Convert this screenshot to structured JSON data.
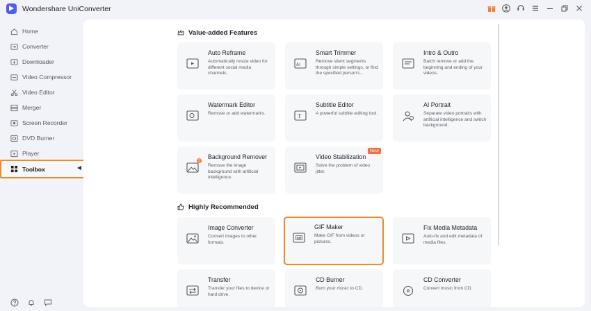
{
  "window": {
    "title": "Wondershare UniConverter"
  },
  "sidebar": {
    "items": [
      {
        "label": "Home",
        "icon": "home-icon"
      },
      {
        "label": "Converter",
        "icon": "converter-icon"
      },
      {
        "label": "Downloader",
        "icon": "download-icon"
      },
      {
        "label": "Video Compressor",
        "icon": "compress-icon"
      },
      {
        "label": "Video Editor",
        "icon": "scissors-icon"
      },
      {
        "label": "Merger",
        "icon": "merge-icon"
      },
      {
        "label": "Screen Recorder",
        "icon": "record-icon"
      },
      {
        "label": "DVD Burner",
        "icon": "disc-icon"
      },
      {
        "label": "Player",
        "icon": "player-icon"
      },
      {
        "label": "Toolbox",
        "icon": "toolbox-icon",
        "active": true
      }
    ]
  },
  "sections": {
    "value_added": {
      "title": "Value-added Features",
      "cards": [
        {
          "title": "Auto Reframe",
          "desc": "Automatically resize video for different social media channels."
        },
        {
          "title": "Smart Trimmer",
          "desc": "Remove silent segments through simple settings, or find the specified person's..."
        },
        {
          "title": "Intro & Outro",
          "desc": "Batch remove or add the beginning and ending of your videos."
        },
        {
          "title": "Watermark Editor",
          "desc": "Remove or add watermarks."
        },
        {
          "title": "Subtitle Editor",
          "desc": "A powerful subtitle editing tool."
        },
        {
          "title": "AI Portrait",
          "desc": "Separate video portraits with artificial intelligence and switch background."
        },
        {
          "title": "Background Remover",
          "desc": "Remove the image background with artificial intelligence."
        },
        {
          "title": "Video Stabilization",
          "desc": "Solve the problem of video jitter.",
          "badge": "New"
        }
      ]
    },
    "recommended": {
      "title": "Highly Recommended",
      "cards": [
        {
          "title": "Image Converter",
          "desc": "Convert images to other formats."
        },
        {
          "title": "GIF Maker",
          "desc": "Make GIF from videos or pictures."
        },
        {
          "title": "Fix Media Metadata",
          "desc": "Auto-fix and edit metadata of media files."
        },
        {
          "title": "Transfer",
          "desc": "Transfer your files to device or hard drive."
        },
        {
          "title": "CD Burner",
          "desc": "Burn your music to CD."
        },
        {
          "title": "CD Converter",
          "desc": "Convert music from CD."
        }
      ]
    }
  },
  "colors": {
    "accent": "#f5882a",
    "new_badge": "#ff6b3d"
  }
}
